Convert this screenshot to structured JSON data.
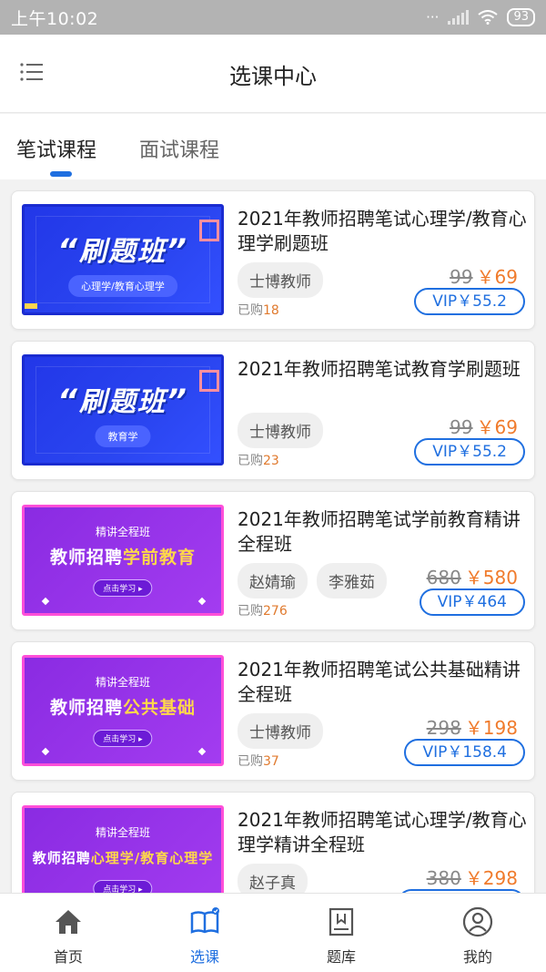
{
  "status": {
    "time": "上午10:02",
    "battery": "93"
  },
  "header": {
    "title": "选课中心"
  },
  "tabs": [
    {
      "label": "笔试课程"
    },
    {
      "label": "面试课程"
    }
  ],
  "courses": [
    {
      "thumb": {
        "style": "blue",
        "main": "刷题班",
        "sub": "心理学/教育心理学"
      },
      "title": "2021年教师招聘笔试心理学/教育心理学刷题班",
      "teachers": [
        "士博教师"
      ],
      "bought_label": "已购",
      "bought_count": "18",
      "old_price": "99",
      "price": "￥69",
      "vip": "VIP￥55.2"
    },
    {
      "thumb": {
        "style": "blue",
        "main": "刷题班",
        "sub": "教育学"
      },
      "title": "2021年教师招聘笔试教育学刷题班",
      "teachers": [
        "士博教师"
      ],
      "bought_label": "已购",
      "bought_count": "23",
      "old_price": "99",
      "price": "￥69",
      "vip": "VIP￥55.2"
    },
    {
      "thumb": {
        "style": "purple",
        "cap": "精讲全程班",
        "main_a": "教师招聘",
        "main_b": "学前教育",
        "btn": "点击学习 ▸"
      },
      "title": "2021年教师招聘笔试学前教育精讲全程班",
      "teachers": [
        "赵婧瑜",
        "李雅茹"
      ],
      "bought_label": "已购",
      "bought_count": "276",
      "old_price": "680",
      "price": "￥580",
      "vip": "VIP￥464"
    },
    {
      "thumb": {
        "style": "purple",
        "cap": "精讲全程班",
        "main_a": "教师招聘",
        "main_b": "公共基础",
        "btn": "点击学习 ▸"
      },
      "title": "2021年教师招聘笔试公共基础精讲全程班",
      "teachers": [
        "士博教师"
      ],
      "bought_label": "已购",
      "bought_count": "37",
      "old_price": "298",
      "price": "￥198",
      "vip": "VIP￥158.4"
    },
    {
      "thumb": {
        "style": "purple",
        "cap": "精讲全程班",
        "main_a": "教师招聘",
        "main_b": "心理学/教育心理学",
        "btn": "点击学习 ▸"
      },
      "title": "2021年教师招聘笔试心理学/教育心理学精讲全程班",
      "teachers": [
        "赵子真"
      ],
      "bought_label": "",
      "bought_count": "",
      "old_price": "380",
      "price": "￥298",
      "vip": ""
    }
  ],
  "nav": [
    {
      "label": "首页",
      "icon": "home-icon"
    },
    {
      "label": "选课",
      "icon": "book-icon"
    },
    {
      "label": "题库",
      "icon": "question-bank-icon"
    },
    {
      "label": "我的",
      "icon": "user-icon"
    }
  ],
  "colors": {
    "accent": "#1f6fe0",
    "price": "#f07b2c"
  }
}
